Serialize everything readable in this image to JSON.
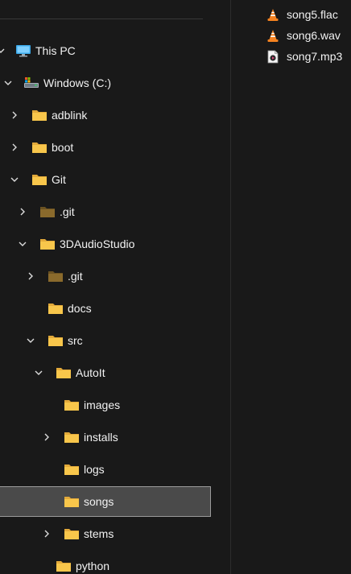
{
  "nav_tree": [
    {
      "label": "This PC",
      "icon": "monitor-icon",
      "expander": "expanded",
      "name": "tree-item-this-pc"
    },
    {
      "label": "Windows (C:)",
      "icon": "drive-icon",
      "expander": "expanded",
      "name": "tree-item-windows-c"
    },
    {
      "label": "adblink",
      "icon": "folder-icon",
      "expander": "collapsed",
      "name": "tree-item-adblink"
    },
    {
      "label": "boot",
      "icon": "folder-icon",
      "expander": "collapsed",
      "name": "tree-item-boot"
    },
    {
      "label": "Git",
      "icon": "folder-icon",
      "expander": "expanded",
      "name": "tree-item-git"
    },
    {
      "label": ".git",
      "icon": "hidden-folder-icon",
      "expander": "collapsed",
      "name": "tree-item-dot-git"
    },
    {
      "label": "3DAudioStudio",
      "icon": "folder-icon",
      "expander": "expanded",
      "name": "tree-item-3daudiostudio"
    },
    {
      "label": ".git",
      "icon": "hidden-folder-icon",
      "expander": "collapsed",
      "name": "tree-item-dot-git-2"
    },
    {
      "label": "docs",
      "icon": "folder-icon",
      "expander": "none",
      "name": "tree-item-docs"
    },
    {
      "label": "src",
      "icon": "folder-icon",
      "expander": "expanded",
      "name": "tree-item-src"
    },
    {
      "label": "AutoIt",
      "icon": "folder-icon",
      "expander": "expanded",
      "name": "tree-item-autoit"
    },
    {
      "label": "images",
      "icon": "folder-icon",
      "expander": "none",
      "name": "tree-item-images"
    },
    {
      "label": "installs",
      "icon": "folder-icon",
      "expander": "collapsed",
      "name": "tree-item-installs"
    },
    {
      "label": "logs",
      "icon": "folder-icon",
      "expander": "none",
      "name": "tree-item-logs"
    },
    {
      "label": "songs",
      "icon": "folder-icon",
      "expander": "none",
      "selected": true,
      "name": "tree-item-songs"
    },
    {
      "label": "stems",
      "icon": "folder-icon",
      "expander": "collapsed",
      "name": "tree-item-stems"
    },
    {
      "label": "python",
      "icon": "folder-icon",
      "expander": "none",
      "name": "tree-item-python"
    }
  ],
  "files": [
    {
      "name": "song5.flac",
      "icon": "vlc-cone-icon"
    },
    {
      "name": "song6.wav",
      "icon": "vlc-cone-icon"
    },
    {
      "name": "song7.mp3",
      "icon": "media-file-icon"
    }
  ],
  "colors": {
    "background": "#191919",
    "selection": "#4a4a4a",
    "selection_border": "#9b9b9b",
    "folder_yellow": "#f8c64b",
    "hidden_folder": "#8a6a2c",
    "vlc_orange": "#f58220",
    "text": "#f2f2f2"
  }
}
